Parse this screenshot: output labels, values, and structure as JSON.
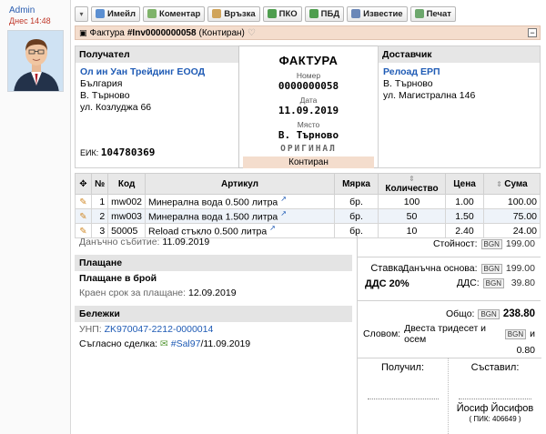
{
  "author": {
    "name": "Admin",
    "date": "Днес 14:48"
  },
  "toolbar": {
    "buttons": [
      {
        "label": "Имейл",
        "icon": "mail-icon",
        "color": "#5b8fd1"
      },
      {
        "label": "Коментар",
        "icon": "comment-icon",
        "color": "#7fb36a"
      },
      {
        "label": "Връзка",
        "icon": "link-icon",
        "color": "#d0a45a"
      },
      {
        "label": "ПКО",
        "icon": "cash-icon",
        "color": "#4f9e4f"
      },
      {
        "label": "ПБД",
        "icon": "bank-icon",
        "color": "#4f9e4f"
      },
      {
        "label": "Известие",
        "icon": "notice-icon",
        "color": "#6b88b8"
      },
      {
        "label": "Печат",
        "icon": "print-icon",
        "color": "#6ca76c"
      }
    ]
  },
  "docbar": {
    "prefix": "Фактура",
    "number": "#Inv0000000058",
    "status": "(Контиран)"
  },
  "buyer": {
    "heading": "Получател",
    "name": "Ол ин Уан Трейдинг ЕООД",
    "country": "България",
    "city": "В. Търново",
    "address": "ул. Козлуджа 66",
    "eik_label": "ЕИК:",
    "eik": "104780369"
  },
  "invoice": {
    "title": "ФАКТУРА",
    "number_label": "Номер",
    "number": "0000000058",
    "date_label": "Дата",
    "date": "11.09.2019",
    "place_label": "Място",
    "place": "В. Търново",
    "original": "ОРИГИНАЛ",
    "status": "Контиран"
  },
  "supplier": {
    "heading": "Доставчик",
    "name": "Релоад ЕРП",
    "city": "В. Търново",
    "address": "ул. Магистрална 146"
  },
  "items": {
    "headers": [
      "№",
      "Код",
      "Артикул",
      "Мярка",
      "Количество",
      "Цена",
      "Сума"
    ],
    "rows": [
      {
        "n": "1",
        "code": "mw002",
        "name": "Минерална вода 0.500 литра",
        "unit": "бр.",
        "qty": "100",
        "price": "1.00",
        "sum": "100.00"
      },
      {
        "n": "2",
        "code": "mw003",
        "name": "Минерална вода 1.500 литра",
        "unit": "бр.",
        "qty": "50",
        "price": "1.50",
        "sum": "75.00"
      },
      {
        "n": "3",
        "code": "50005",
        "name": "Reload стъкло 0.500 литра",
        "unit": "бр.",
        "qty": "10",
        "price": "2.40",
        "sum": "24.00"
      }
    ]
  },
  "tax_event": {
    "label": "Данъчно събитие:",
    "value": "11.09.2019"
  },
  "payment": {
    "heading": "Плащане",
    "method": "Плащане в брой",
    "due_label": "Краен срок за плащане:",
    "due": "12.09.2019"
  },
  "notes": {
    "heading": "Бележки",
    "unp_label": "УНП:",
    "unp": "ZK970047-2212-0000014",
    "deal_label": "Съгласно сделка:",
    "deal_link": "#Sal97",
    "deal_date": "/11.09.2019"
  },
  "totals": {
    "currency": "BGN",
    "value_label": "Стойност:",
    "value": "199.00",
    "rate_label": "Ставка",
    "rate": "ДДС 20%",
    "base_label": "Данъчна основа:",
    "base": "199.00",
    "vat_label": "ДДС:",
    "vat": "39.80",
    "total_label": "Общо:",
    "total": "238.80",
    "words_label": "Словом:",
    "words": "Двеста тридесет и осем",
    "words_suffix": "и",
    "words_cents": "0.80"
  },
  "signatures": {
    "received_label": "Получил:",
    "composed_label": "Съставил:",
    "composer": "Йосиф Йосифов",
    "composer_pik": "( ПИК: 406649 )"
  }
}
